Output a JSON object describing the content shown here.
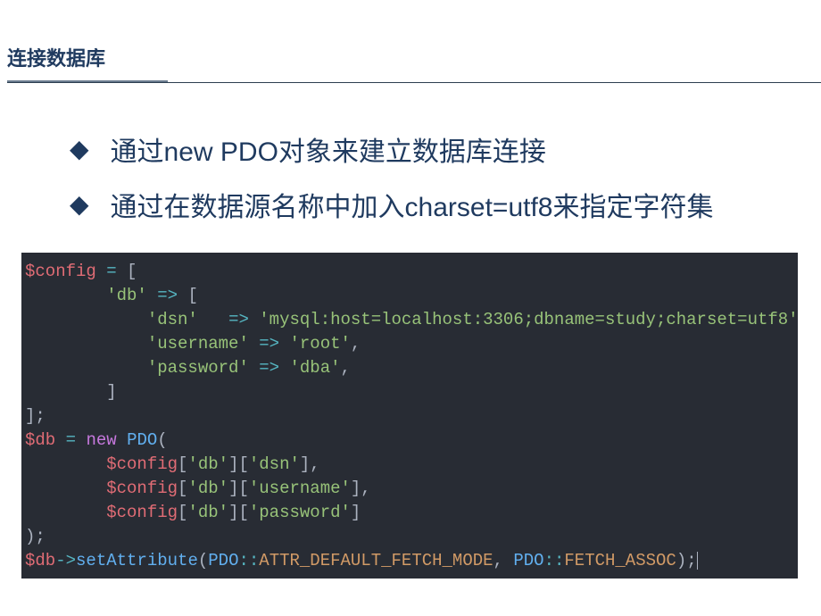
{
  "header": {
    "title": "连接数据库"
  },
  "bullets": [
    "通过new PDO对象来建立数据库连接",
    "通过在数据源名称中加入charset=utf8来指定字符集"
  ],
  "code": {
    "tokens": [
      [
        [
          "var",
          "$config"
        ],
        [
          "punc",
          " "
        ],
        [
          "op",
          "="
        ],
        [
          "punc",
          " ["
        ]
      ],
      [
        [
          "punc",
          "        "
        ],
        [
          "str",
          "'db'"
        ],
        [
          "punc",
          " "
        ],
        [
          "op",
          "=>"
        ],
        [
          "punc",
          " ["
        ]
      ],
      [
        [
          "punc",
          "            "
        ],
        [
          "str",
          "'dsn'"
        ],
        [
          "punc",
          "   "
        ],
        [
          "op",
          "=>"
        ],
        [
          "punc",
          " "
        ],
        [
          "str",
          "'mysql:host=localhost:3306;dbname=study;charset=utf8'"
        ],
        [
          "punc",
          ","
        ]
      ],
      [
        [
          "punc",
          "            "
        ],
        [
          "str",
          "'username'"
        ],
        [
          "punc",
          " "
        ],
        [
          "op",
          "=>"
        ],
        [
          "punc",
          " "
        ],
        [
          "str",
          "'root'"
        ],
        [
          "punc",
          ","
        ]
      ],
      [
        [
          "punc",
          "            "
        ],
        [
          "str",
          "'password'"
        ],
        [
          "punc",
          " "
        ],
        [
          "op",
          "=>"
        ],
        [
          "punc",
          " "
        ],
        [
          "str",
          "'dba'"
        ],
        [
          "punc",
          ","
        ]
      ],
      [
        [
          "punc",
          "        ]"
        ]
      ],
      [
        [
          "punc",
          "];"
        ]
      ],
      [
        [
          "var",
          "$db"
        ],
        [
          "punc",
          " "
        ],
        [
          "op",
          "="
        ],
        [
          "punc",
          " "
        ],
        [
          "key",
          "new"
        ],
        [
          "punc",
          " "
        ],
        [
          "type",
          "PDO"
        ],
        [
          "punc",
          "("
        ]
      ],
      [
        [
          "punc",
          "        "
        ],
        [
          "var",
          "$config"
        ],
        [
          "punc",
          "["
        ],
        [
          "str",
          "'db'"
        ],
        [
          "punc",
          "]["
        ],
        [
          "str",
          "'dsn'"
        ],
        [
          "punc",
          "],"
        ]
      ],
      [
        [
          "punc",
          "        "
        ],
        [
          "var",
          "$config"
        ],
        [
          "punc",
          "["
        ],
        [
          "str",
          "'db'"
        ],
        [
          "punc",
          "]["
        ],
        [
          "str",
          "'username'"
        ],
        [
          "punc",
          "],"
        ]
      ],
      [
        [
          "punc",
          "        "
        ],
        [
          "var",
          "$config"
        ],
        [
          "punc",
          "["
        ],
        [
          "str",
          "'db'"
        ],
        [
          "punc",
          "]["
        ],
        [
          "str",
          "'password'"
        ],
        [
          "punc",
          "]"
        ]
      ],
      [
        [
          "punc",
          ");"
        ]
      ],
      [
        [
          "var",
          "$db"
        ],
        [
          "op",
          "->"
        ],
        [
          "func",
          "setAttribute"
        ],
        [
          "punc",
          "("
        ],
        [
          "type",
          "PDO"
        ],
        [
          "op",
          "::"
        ],
        [
          "const",
          "ATTR_DEFAULT_FETCH_MODE"
        ],
        [
          "punc",
          ", "
        ],
        [
          "type",
          "PDO"
        ],
        [
          "op",
          "::"
        ],
        [
          "const",
          "FETCH_ASSOC"
        ],
        [
          "punc",
          ");"
        ]
      ]
    ]
  }
}
